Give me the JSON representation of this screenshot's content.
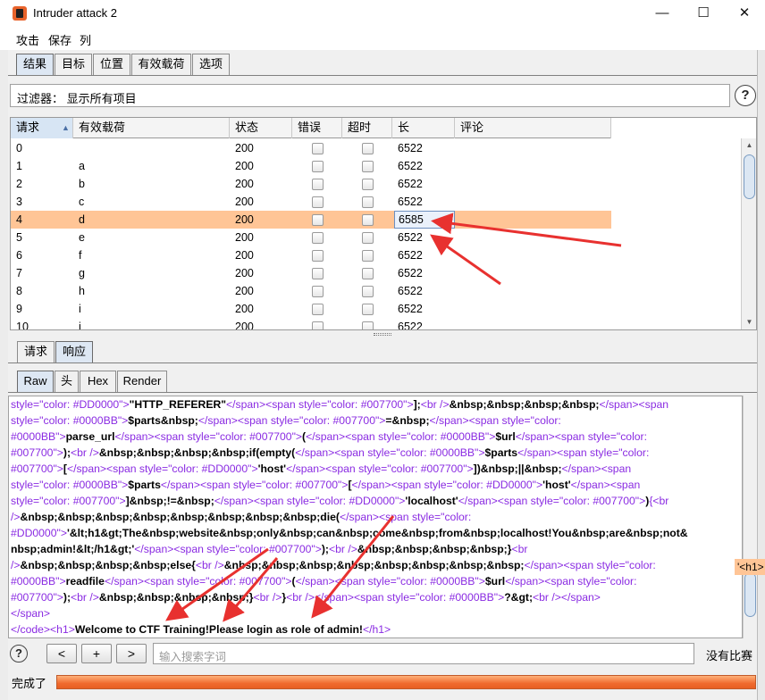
{
  "window": {
    "title": "Intruder attack 2",
    "minimize": "—",
    "maximize": "☐",
    "close": "✕"
  },
  "menu": [
    "攻击",
    "保存",
    "列"
  ],
  "top_tabs": [
    "结果",
    "目标",
    "位置",
    "有效载荷",
    "选项"
  ],
  "filter": {
    "text": "过滤器： 显示所有项目"
  },
  "help_icon": "?",
  "table": {
    "columns": [
      "请求",
      "有效载荷",
      "状态",
      "错误",
      "超时",
      "长",
      "评论"
    ],
    "sort_indicator": "▲",
    "selected_row": 4,
    "rows": [
      {
        "req": "0",
        "payload": "",
        "status": "200",
        "length": "6522"
      },
      {
        "req": "1",
        "payload": "a",
        "status": "200",
        "length": "6522"
      },
      {
        "req": "2",
        "payload": "b",
        "status": "200",
        "length": "6522"
      },
      {
        "req": "3",
        "payload": "c",
        "status": "200",
        "length": "6522"
      },
      {
        "req": "4",
        "payload": "d",
        "status": "200",
        "length": "6585"
      },
      {
        "req": "5",
        "payload": "e",
        "status": "200",
        "length": "6522"
      },
      {
        "req": "6",
        "payload": "f",
        "status": "200",
        "length": "6522"
      },
      {
        "req": "7",
        "payload": "g",
        "status": "200",
        "length": "6522"
      },
      {
        "req": "8",
        "payload": "h",
        "status": "200",
        "length": "6522"
      },
      {
        "req": "9",
        "payload": "i",
        "status": "200",
        "length": "6522"
      },
      {
        "req": "10",
        "payload": "j",
        "status": "200",
        "length": "6522"
      }
    ]
  },
  "req_resp_tabs": [
    "请求",
    "响应"
  ],
  "view_tabs": [
    "Raw",
    "头",
    "Hex",
    "Render"
  ],
  "code_lines": [
    [
      [
        "pu",
        "style=\"color: #DD0000\">"
      ],
      [
        "b",
        "\"HTTP_REFERER\""
      ],
      [
        "pu",
        "</span><span style=\"color: #007700\">"
      ],
      [
        "b",
        "];"
      ],
      [
        "pu",
        "<br />"
      ],
      [
        "b",
        "&nbsp;&nbsp;&nbsp;&nbsp;"
      ],
      [
        "pu",
        "</span><span"
      ]
    ],
    [
      [
        "pu",
        "style=\"color: #0000BB\">"
      ],
      [
        "b",
        "$parts&nbsp;"
      ],
      [
        "pu",
        "</span><span style=\"color: #007700\">"
      ],
      [
        "b",
        "=&nbsp;"
      ],
      [
        "pu",
        "</span><span style=\"color:"
      ]
    ],
    [
      [
        "pu",
        "#0000BB\">"
      ],
      [
        "b",
        "parse_url"
      ],
      [
        "pu",
        "</span><span style=\"color: #007700\">"
      ],
      [
        "b",
        "("
      ],
      [
        "pu",
        "</span><span style=\"color: #0000BB\">"
      ],
      [
        "b",
        "$url"
      ],
      [
        "pu",
        "</span><span style=\"color:"
      ]
    ],
    [
      [
        "pu",
        "#007700\">"
      ],
      [
        "b",
        ");"
      ],
      [
        "pu",
        "<br />"
      ],
      [
        "b",
        "&nbsp;&nbsp;&nbsp;&nbsp;if(empty("
      ],
      [
        "pu",
        "</span><span style=\"color: #0000BB\">"
      ],
      [
        "b",
        "$parts"
      ],
      [
        "pu",
        "</span><span style=\"color:"
      ]
    ],
    [
      [
        "pu",
        "#007700\">"
      ],
      [
        "b",
        "["
      ],
      [
        "pu",
        "</span><span style=\"color: #DD0000\">"
      ],
      [
        "b",
        "'host'"
      ],
      [
        "pu",
        "</span><span style=\"color: #007700\">"
      ],
      [
        "b",
        "])&nbsp;||&nbsp;"
      ],
      [
        "pu",
        "</span><span"
      ]
    ],
    [
      [
        "pu",
        "style=\"color: #0000BB\">"
      ],
      [
        "b",
        "$parts"
      ],
      [
        "pu",
        "</span><span style=\"color: #007700\">"
      ],
      [
        "b",
        "["
      ],
      [
        "pu",
        "</span><span style=\"color: #DD0000\">"
      ],
      [
        "b",
        "'host'"
      ],
      [
        "pu",
        "</span><span"
      ]
    ],
    [
      [
        "pu",
        "style=\"color: #007700\">"
      ],
      [
        "b",
        "]&nbsp;!=&nbsp;"
      ],
      [
        "pu",
        "</span><span style=\"color: #DD0000\">"
      ],
      [
        "b",
        "'localhost'"
      ],
      [
        "pu",
        "</span><span style=\"color: #007700\">"
      ],
      [
        "b",
        ")"
      ],
      [
        "pu",
        "{<br"
      ]
    ],
    [
      [
        "pu",
        "/>"
      ],
      [
        "b",
        "&nbsp;&nbsp;&nbsp;&nbsp;&nbsp;&nbsp;&nbsp;&nbsp;die("
      ],
      [
        "pu",
        "</span><span style=\"color:"
      ]
    ],
    [
      [
        "pu",
        "#DD0000\">"
      ],
      [
        "b",
        "'&lt;h1&gt;The&nbsp;website&nbsp;only&nbsp;can&nbsp;come&nbsp;from&nbsp;localhost!You&nbsp;are&nbsp;not&"
      ]
    ],
    [
      [
        "b",
        "nbsp;admin!&lt;/h1&gt;'"
      ],
      [
        "pu",
        "</span><span style=\"color: #007700\">"
      ],
      [
        "b",
        ");"
      ],
      [
        "pu",
        "<br />"
      ],
      [
        "b",
        "&nbsp;&nbsp;&nbsp;&nbsp;}"
      ],
      [
        "pu",
        "<br"
      ]
    ],
    [
      [
        "pu",
        "/>"
      ],
      [
        "b",
        "&nbsp;&nbsp;&nbsp;&nbsp;else{"
      ],
      [
        "pu",
        "<br />"
      ],
      [
        "b",
        "&nbsp;&nbsp;&nbsp;&nbsp;&nbsp;&nbsp;&nbsp;&nbsp;"
      ],
      [
        "pu",
        "</span><span style=\"color:"
      ]
    ],
    [
      [
        "pu",
        "#0000BB\">"
      ],
      [
        "b",
        "readfile"
      ],
      [
        "pu",
        "</span><span style=\"color: #007700\">"
      ],
      [
        "b",
        "("
      ],
      [
        "pu",
        "</span><span style=\"color: #0000BB\">"
      ],
      [
        "b",
        "$url"
      ],
      [
        "pu",
        "</span><span style=\"color:"
      ]
    ],
    [
      [
        "pu",
        "#007700\">"
      ],
      [
        "b",
        ");"
      ],
      [
        "pu",
        "<br />"
      ],
      [
        "b",
        "&nbsp;&nbsp;&nbsp;&nbsp;}"
      ],
      [
        "pu",
        "<br />"
      ],
      [
        "b",
        "}"
      ],
      [
        "pu",
        "<br />"
      ],
      [
        "pu",
        "</span><span style=\"color: #0000BB\">"
      ],
      [
        "b",
        "?&gt;"
      ],
      [
        "pu",
        "<br /></span>"
      ]
    ],
    [
      [
        "pu",
        "</span>"
      ]
    ],
    [
      [
        "pu",
        "</code><h1>"
      ],
      [
        "b",
        "Welcome to CTF Training!Please login as role of admin!"
      ],
      [
        "pu",
        "</h1>"
      ]
    ]
  ],
  "hint_tag": "'<h1>",
  "search": {
    "prev": "<",
    "add": "+",
    "next": ">",
    "placeholder": "输入搜索字词",
    "result": "没有比赛"
  },
  "status": {
    "text": "完成了",
    "progress": 1.0
  },
  "colors": {
    "selected_row": "#ffc596",
    "progress": "#f06a2e",
    "arrow": "#e8312f"
  }
}
